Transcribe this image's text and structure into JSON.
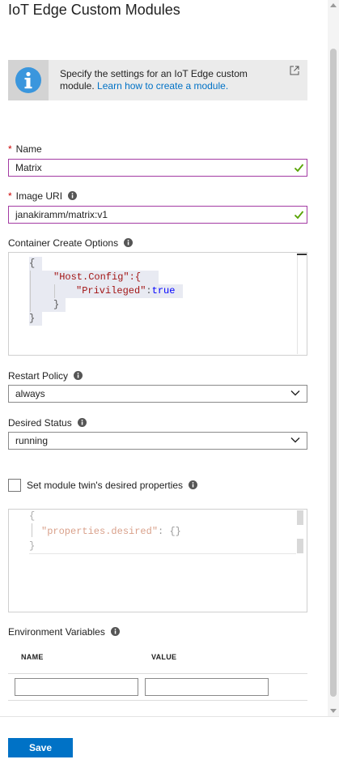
{
  "header": {
    "title": "IoT Edge Custom Modules"
  },
  "info": {
    "text": "Specify the settings for an IoT Edge custom module.",
    "link": "Learn how to create a module."
  },
  "name_field": {
    "label": "Name",
    "required_mark": "*",
    "value": "Matrix"
  },
  "image_field": {
    "label": "Image URI",
    "required_mark": "*",
    "value": "janakiramm/matrix:v1"
  },
  "container_options": {
    "label": "Container Create Options",
    "lines": [
      "{",
      "\"Host.Config\":{",
      "\"Privileged\"",
      ":",
      "true",
      "}",
      "}"
    ]
  },
  "restart_policy": {
    "label": "Restart Policy",
    "value": "always"
  },
  "desired_status": {
    "label": "Desired Status",
    "value": "running"
  },
  "twin": {
    "checkbox_label": "Set module twin's desired properties",
    "checked": false,
    "code": {
      "open": "{",
      "key": "\"properties.desired\"",
      "sep": ": ",
      "value": "{}",
      "close": "}"
    }
  },
  "env": {
    "label": "Environment Variables",
    "columns": [
      "NAME",
      "VALUE"
    ],
    "name_value": "",
    "value_value": ""
  },
  "footer": {
    "save_label": "Save"
  },
  "colors": {
    "accent": "#0072c6",
    "valid_border": "#a33ba3",
    "check": "#57a300",
    "info_icon": "#3a96dd"
  }
}
